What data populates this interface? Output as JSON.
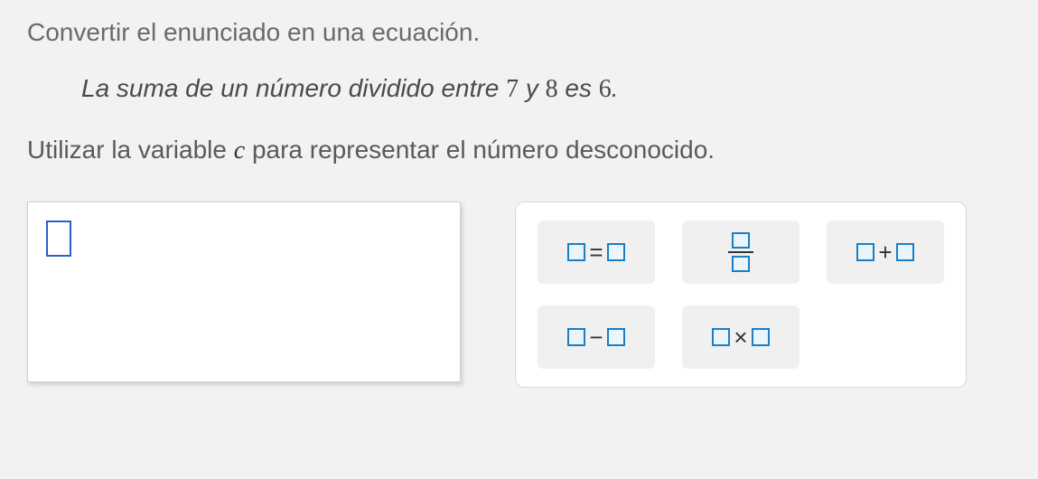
{
  "instruction": "Convertir el enunciado en una ecuación.",
  "problem": {
    "prefix": "La suma de un número dividido entre ",
    "n1": "7",
    "mid1": " y ",
    "n2": "8",
    "mid2": " es ",
    "n3": "6",
    "suffix": "."
  },
  "variable_line": {
    "prefix": "Utilizar la variable ",
    "var": "c",
    "suffix": " para representar el número desconocido."
  },
  "palette": {
    "equals": "=",
    "plus": "+",
    "minus": "−",
    "times": "×"
  }
}
